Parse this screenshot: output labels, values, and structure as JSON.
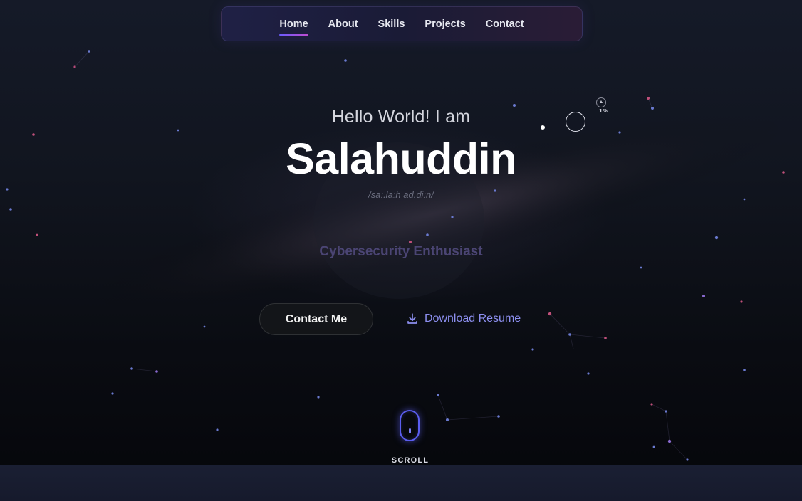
{
  "nav": {
    "items": [
      {
        "label": "Home",
        "active": true
      },
      {
        "label": "About",
        "active": false
      },
      {
        "label": "Skills",
        "active": false
      },
      {
        "label": "Projects",
        "active": false
      },
      {
        "label": "Contact",
        "active": false
      }
    ]
  },
  "hero": {
    "greeting": "Hello World! I am",
    "name": "Salahuddin",
    "phonetic": "/saː.laːh ad.diːn/",
    "role": "Cybersecurity Enthusiast",
    "contact_button": "Contact Me",
    "resume_button": "Download Resume"
  },
  "scroll_indicator": {
    "up_glyph": "▲",
    "percent": "1%"
  },
  "scroll": {
    "label": "SCROLL"
  },
  "colors": {
    "accent": "#6a5cff",
    "accent_pink": "#c04cd0",
    "resume_link": "#8d8ff0",
    "role_text": "#4b4574",
    "background": "#0b0e18"
  },
  "icons": {
    "resume": "download-icon",
    "scroll": "mouse-icon"
  }
}
